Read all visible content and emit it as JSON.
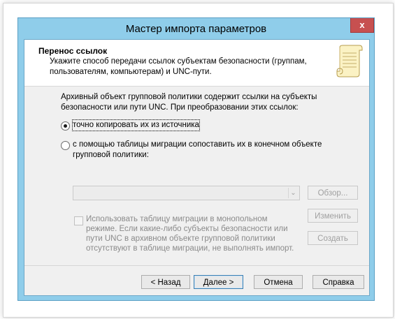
{
  "window": {
    "title": "Мастер импорта параметров",
    "close_label": "x"
  },
  "header": {
    "title": "Перенос ссылок",
    "subtitle": "Укажите способ передачи ссылок субъектам безопасности (группам, пользователям, компьютерам) и UNC-пути."
  },
  "body": {
    "description": "Архивный объект групповой политики содержит ссылки на субъекты безопасности или пути UNC.  При преобразовании этих ссылок:",
    "option_copy": "точно копировать их из источника",
    "option_copy_selected": true,
    "option_map": "с помощью таблицы миграции сопоставить их в конечном объекте групповой политики:",
    "migration_table_value": "",
    "browse_label": "Обзор...",
    "edit_label": "Изменить",
    "create_label": "Создать",
    "exclusive_checkbox_text": "Использовать таблицу миграции в монопольном режиме. Если какие-либо субъекты безопасности или пути UNC в архивном объекте групповой политики отсутствуют в таблице миграции, не выполнять импорт.",
    "exclusive_checked": false
  },
  "footer": {
    "back_label": "< Назад",
    "next_label": "Далее >",
    "cancel_label": "Отмена",
    "help_label": "Справка"
  }
}
